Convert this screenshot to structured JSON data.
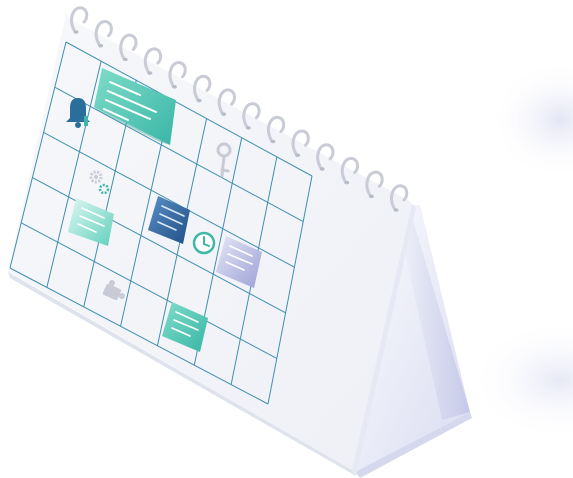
{
  "illustration": {
    "subject": "desk-calendar",
    "grid": {
      "columns": 7,
      "rows": 5
    },
    "ring_count": 14,
    "colors": {
      "grid_line": "#3f8fb0",
      "page": "#f5f7fb",
      "page_edge": "#e3e7f1",
      "stand_light": "#f2f3fb",
      "stand_shadow": "#c9cbe9",
      "ring": "#c9ccd6",
      "note_teal": "#4cc7b3",
      "note_blue": "#2b6aa8",
      "note_lavender": "#b9bde3",
      "icon_teal": "#3fb7a7",
      "icon_blue": "#2a6f9c",
      "icon_grey": "#c8cbd6"
    },
    "icons": [
      "bell-icon",
      "key-icon",
      "gear-icon",
      "clock-icon",
      "puzzle-icon"
    ],
    "notes": [
      "note-teal-large",
      "note-teal-small",
      "note-blue",
      "note-lavender",
      "note-teal-bottom"
    ]
  }
}
